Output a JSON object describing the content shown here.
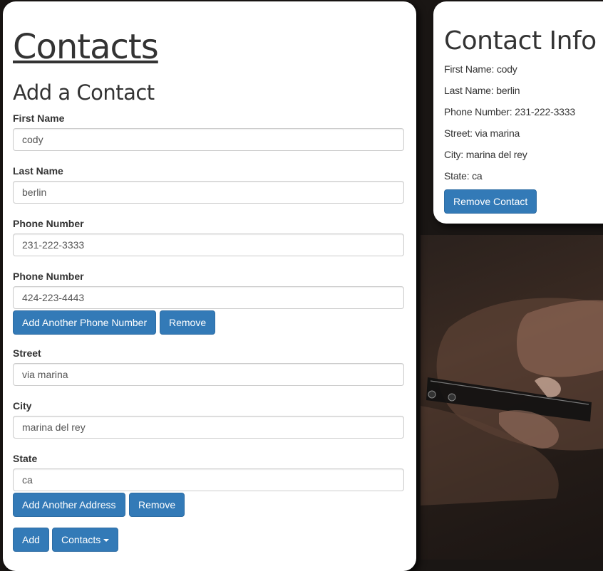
{
  "form": {
    "title": "Contacts",
    "subtitle": "Add a Contact",
    "fields": [
      {
        "label": "First Name",
        "value": "cody"
      },
      {
        "label": "Last Name",
        "value": "berlin"
      },
      {
        "label": "Phone Number",
        "value": "231-222-3333"
      },
      {
        "label": "Phone Number",
        "value": "424-223-4443"
      },
      {
        "label": "Street",
        "value": "via marina"
      },
      {
        "label": "City",
        "value": "marina del rey"
      },
      {
        "label": "State",
        "value": "ca"
      }
    ],
    "add_phone_label": "Add Another Phone Number",
    "remove_phone_label": "Remove",
    "add_address_label": "Add Another Address",
    "remove_address_label": "Remove",
    "add_label": "Add",
    "contacts_label": "Contacts"
  },
  "info": {
    "title": "Contact Info",
    "lines": [
      "First Name: cody",
      "Last Name: berlin",
      "Phone Number: 231-222-3333",
      "Street: via marina",
      "City: marina del rey",
      "State: ca"
    ],
    "remove_contact_label": "Remove Contact"
  },
  "colors": {
    "primary": "#337ab7",
    "background": "#1a1614"
  },
  "icons": {
    "contacts_dropdown": "caret-down-icon"
  }
}
